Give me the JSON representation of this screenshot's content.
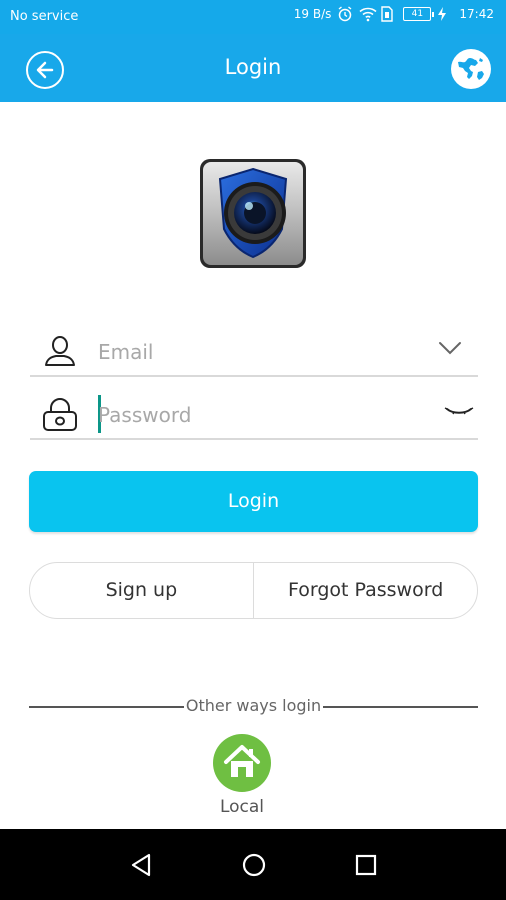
{
  "status_bar": {
    "carrier": "No service",
    "speed": "19 B/s",
    "battery": "41",
    "time": "17:42"
  },
  "app_bar": {
    "title": "Login",
    "back_icon": "back-arrow-icon",
    "language_icon": "globe-icon"
  },
  "form": {
    "email_placeholder": "Email",
    "password_placeholder": "Password",
    "login_label": "Login",
    "signup_label": "Sign up",
    "forgot_label": "Forgot Password"
  },
  "other_ways": {
    "label": "Other ways login",
    "local_label": "Local"
  },
  "colors": {
    "primary": "#18a8ea",
    "login_button": "#09c4ef",
    "local_button": "#6fbf42",
    "caret": "#0b9688"
  }
}
